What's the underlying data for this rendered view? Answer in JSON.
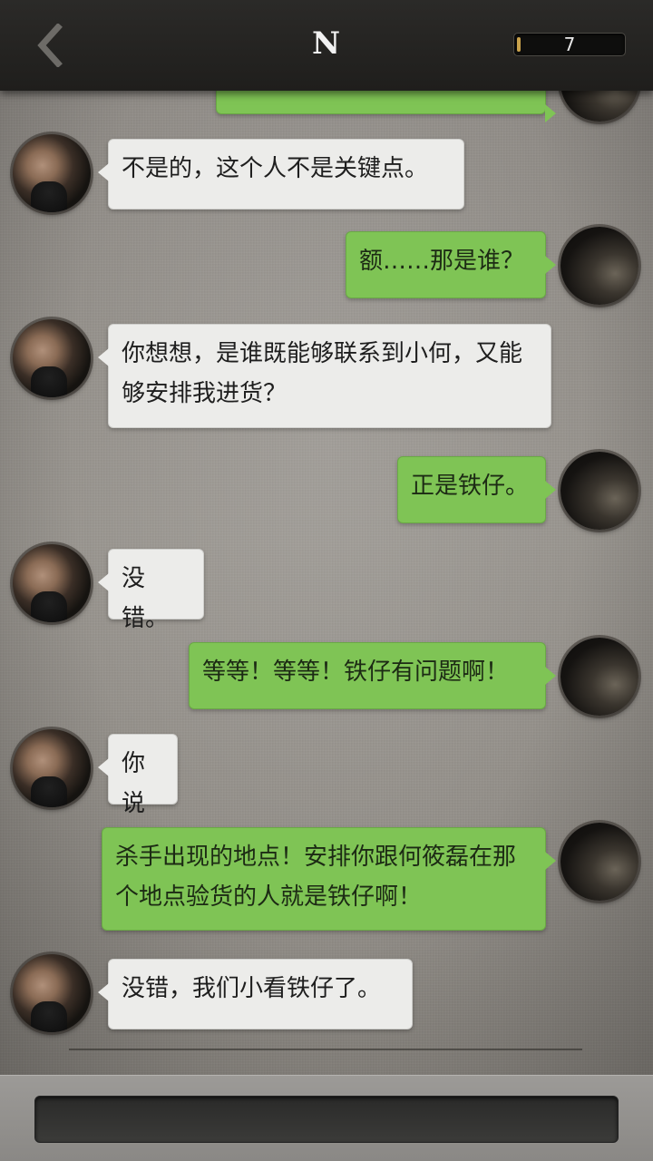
{
  "header": {
    "title": "N",
    "counter": "7",
    "back_icon": "chevron-left-icon"
  },
  "messages": [
    {
      "side": "left",
      "text": "不是的，这个人不是关键点。"
    },
    {
      "side": "right",
      "text": "额……那是谁？"
    },
    {
      "side": "left",
      "text": "你想想，是谁既能够联系到小何，又能够安排我进货？"
    },
    {
      "side": "right",
      "text": "正是铁仔。"
    },
    {
      "side": "left",
      "text": "没错。"
    },
    {
      "side": "right",
      "text": "等等！等等！铁仔有问题啊！"
    },
    {
      "side": "left",
      "text": "你说"
    },
    {
      "side": "right",
      "text": "杀手出现的地点！安排你跟何筱磊在那个地点验货的人就是铁仔啊！"
    },
    {
      "side": "left",
      "text": "没错，我们小看铁仔了。"
    }
  ],
  "colors": {
    "bubble_left": "#ececea",
    "bubble_right": "#7fc455",
    "top_bar": "#242321"
  }
}
